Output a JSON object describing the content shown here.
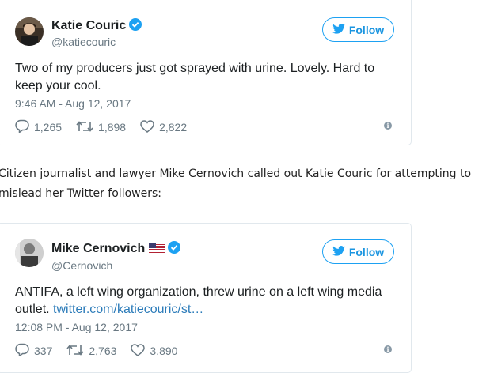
{
  "tweets": [
    {
      "name": "Katie Couric",
      "handle": "@katiecouric",
      "follow_label": "Follow",
      "text": "Two of my producers just got sprayed with urine. Lovely. Hard to keep your cool.",
      "link": "",
      "timestamp": "9:46 AM - Aug 12, 2017",
      "replies": "1,265",
      "retweets": "1,898",
      "likes": "2,822"
    },
    {
      "name": "Mike Cernovich",
      "handle": "@Cernovich",
      "follow_label": "Follow",
      "text": "ANTIFA, a left wing organization, threw urine on a left wing media outlet. ",
      "link": "twitter.com/katiecouric/st…",
      "timestamp": "12:08 PM - Aug 12, 2017",
      "replies": "337",
      "retweets": "2,763",
      "likes": "3,890"
    }
  ],
  "article_text": "Citizen journalist and lawyer Mike Cernovich called out Katie Couric for attempting to mislead her Twitter followers:",
  "colors": {
    "twitter_blue": "#1da1f2",
    "muted": "#697882",
    "border": "#e1e8ed",
    "link": "#2b7bb9"
  },
  "icons": [
    "verified-badge-icon",
    "twitter-bird-icon",
    "reply-icon",
    "retweet-icon",
    "heart-icon",
    "info-icon",
    "us-flag-icon"
  ]
}
